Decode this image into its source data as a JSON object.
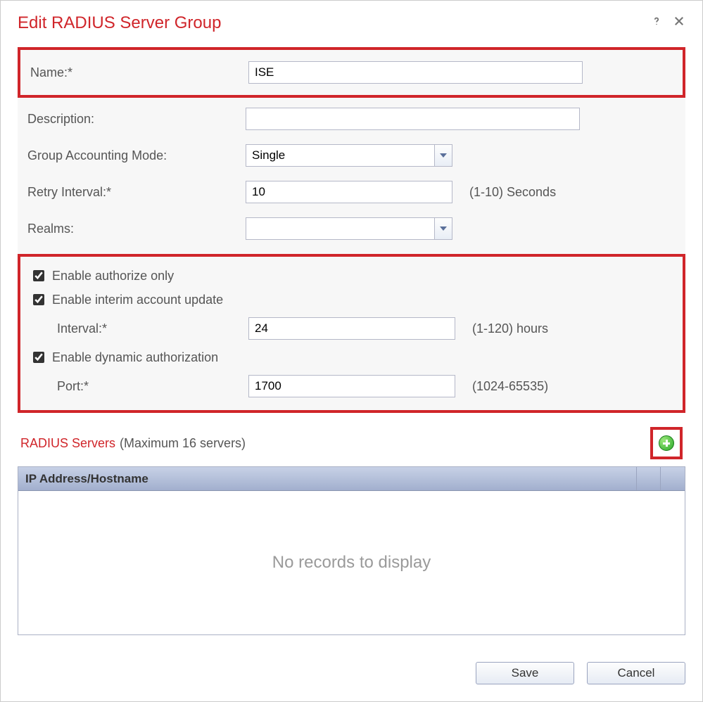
{
  "dialog": {
    "title": "Edit RADIUS Server Group"
  },
  "form": {
    "name": {
      "label": "Name:*",
      "value": "ISE"
    },
    "description": {
      "label": "Description:",
      "value": ""
    },
    "group_accounting_mode": {
      "label": "Group Accounting Mode:",
      "value": "Single"
    },
    "retry_interval": {
      "label": "Retry Interval:*",
      "value": "10",
      "hint": "(1-10) Seconds"
    },
    "realms": {
      "label": "Realms:",
      "value": ""
    },
    "enable_authorize_only": {
      "label": "Enable authorize only",
      "checked": true
    },
    "enable_interim": {
      "label": "Enable interim account update",
      "checked": true
    },
    "interval": {
      "label": "Interval:*",
      "value": "24",
      "hint": "(1-120) hours"
    },
    "enable_dynamic_auth": {
      "label": "Enable dynamic authorization",
      "checked": true
    },
    "port": {
      "label": "Port:*",
      "value": "1700",
      "hint": "(1024-65535)"
    }
  },
  "servers": {
    "title": "RADIUS Servers",
    "subtitle": "(Maximum 16 servers)",
    "column_header": "IP Address/Hostname",
    "empty_text": "No records to display"
  },
  "buttons": {
    "save": "Save",
    "cancel": "Cancel"
  }
}
